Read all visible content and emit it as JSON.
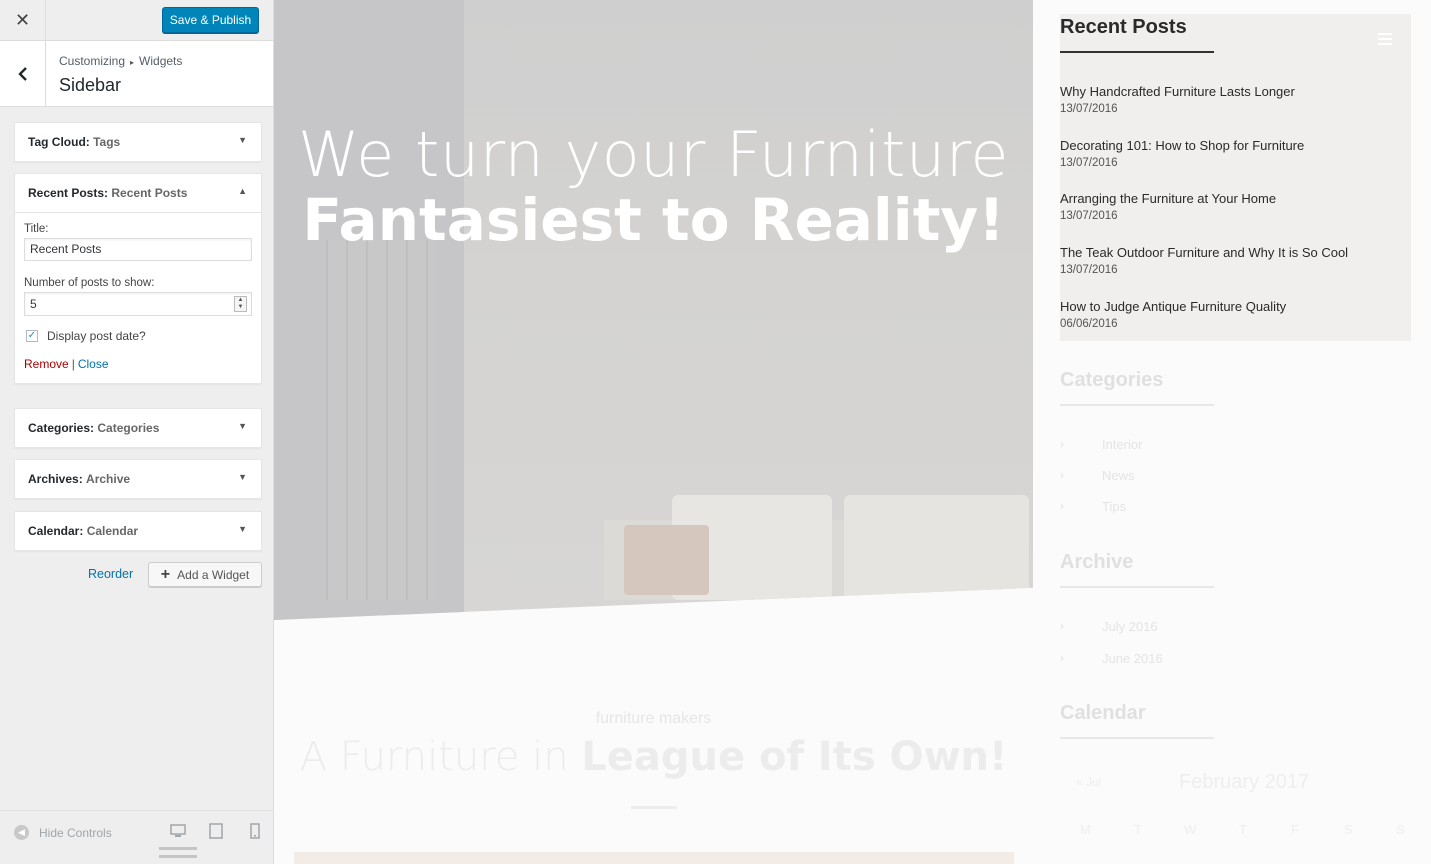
{
  "toolbar": {
    "close_label": "✕",
    "publish_label": "Save & Publish"
  },
  "section": {
    "breadcrumb_root": "Customizing",
    "breadcrumb_sep": "▸",
    "breadcrumb_child": "Widgets",
    "title": "Sidebar"
  },
  "widgets": [
    {
      "type": "Tag Cloud:",
      "instance": "Tags",
      "arrow": "▼"
    },
    {
      "type": "Recent Posts:",
      "instance": "Recent Posts",
      "arrow": "▲"
    },
    {
      "type": "Categories:",
      "instance": "Categories",
      "arrow": "▼"
    },
    {
      "type": "Archives:",
      "instance": "Archive",
      "arrow": "▼"
    },
    {
      "type": "Calendar:",
      "instance": "Calendar",
      "arrow": "▼"
    }
  ],
  "recent_form": {
    "title_label": "Title:",
    "title_value": "Recent Posts",
    "number_label": "Number of posts to show:",
    "number_value": "5",
    "checkbox_label": "Display post date?",
    "checkbox_checked": true,
    "remove_label": "Remove",
    "separator": "|",
    "close_label": "Close"
  },
  "panel_actions": {
    "reorder_label": "Reorder",
    "add_widget_label": "Add a Widget"
  },
  "footer": {
    "hide_controls_label": "Hide Controls"
  },
  "hero": {
    "line1": "We turn your Furniture",
    "line2": "Fantasiest to Reality!"
  },
  "section_below": {
    "tagline": "furniture makers",
    "heading_light": "A Furniture in ",
    "heading_bold": "League of Its Own!"
  },
  "sidebar_preview": {
    "recent_title": "Recent Posts",
    "posts": [
      {
        "title": "Why Handcrafted Furniture Lasts Longer",
        "date": "13/07/2016"
      },
      {
        "title": "Decorating 101: How to Shop for Furniture",
        "date": "13/07/2016"
      },
      {
        "title": "Arranging the Furniture at Your Home",
        "date": "13/07/2016"
      },
      {
        "title": "The Teak Outdoor Furniture and Why It is So Cool",
        "date": "13/07/2016"
      },
      {
        "title": "How to Judge Antique Furniture Quality",
        "date": "06/06/2016"
      }
    ],
    "categories_title": "Categories",
    "categories": [
      "Interior",
      "News",
      "Tips"
    ],
    "archive_title": "Archive",
    "archives": [
      "July 2016",
      "June 2016"
    ],
    "calendar_title": "Calendar",
    "calendar_prev": "« Jul",
    "calendar_month": "February 2017",
    "calendar_days": [
      "M",
      "T",
      "W",
      "T",
      "F",
      "S",
      "S"
    ]
  },
  "colors": {
    "primary_button": "#0085ba",
    "link": "#0073aa",
    "remove_link": "#aa0000"
  },
  "icons": {
    "close": "close-icon",
    "back": "chevron-left-icon",
    "menu": "hamburger-icon",
    "add": "plus-icon",
    "devices": [
      "desktop-icon",
      "tablet-icon",
      "mobile-icon"
    ]
  }
}
